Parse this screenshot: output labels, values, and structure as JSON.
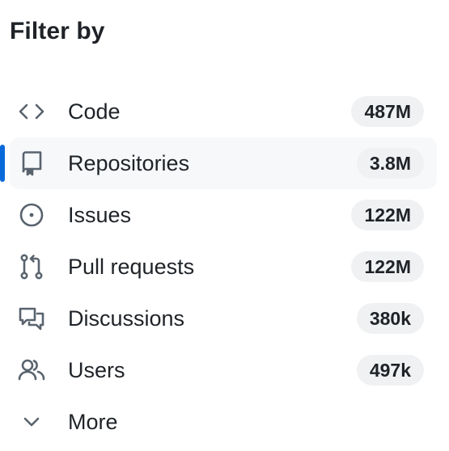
{
  "heading": "Filter by",
  "items": [
    {
      "label": "Code",
      "count": "487M",
      "icon": "code-icon",
      "selected": false
    },
    {
      "label": "Repositories",
      "count": "3.8M",
      "icon": "repo-icon",
      "selected": true
    },
    {
      "label": "Issues",
      "count": "122M",
      "icon": "issue-opened-icon",
      "selected": false
    },
    {
      "label": "Pull requests",
      "count": "122M",
      "icon": "git-pull-request-icon",
      "selected": false
    },
    {
      "label": "Discussions",
      "count": "380k",
      "icon": "comment-discussion-icon",
      "selected": false
    },
    {
      "label": "Users",
      "count": "497k",
      "icon": "people-icon",
      "selected": false
    }
  ],
  "more": {
    "label": "More",
    "icon": "chevron-down-icon"
  },
  "colors": {
    "text": "#1f2328",
    "icon": "#59636e",
    "selected_bg": "#f6f8fa",
    "selected_accent": "#0969da",
    "counter_bg": "#eff1f3"
  }
}
